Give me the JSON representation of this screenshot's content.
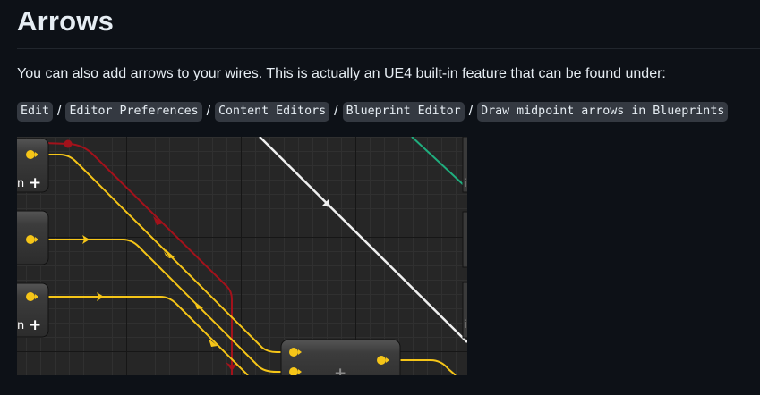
{
  "page": {
    "heading": "Arrows",
    "intro": "You can also add arrows to your wires. This is actually an UE4 built-in feature that can be found under:",
    "path": [
      "Edit",
      "Editor Preferences",
      "Content Editors",
      "Blueprint Editor",
      "Draw midpoint arrows in Blueprints"
    ],
    "separator": "/"
  },
  "blueprint": {
    "pin_label_1": "n",
    "pin_label_2": "n",
    "right_label_1": "i",
    "right_label_2": "i",
    "add_glyph": "+",
    "colors": {
      "exec_wire": "#f5c518",
      "red_wire": "#a3121b",
      "white_wire": "#f0f0f0",
      "green_wire": "#1fae7e",
      "node_body": "#3a3a3a",
      "grid_major": "#161616",
      "grid_minor": "#303030",
      "canvas_bg": "#262626"
    },
    "icons": [
      "plus-icon",
      "arrow-icon",
      "pin-icon"
    ]
  }
}
